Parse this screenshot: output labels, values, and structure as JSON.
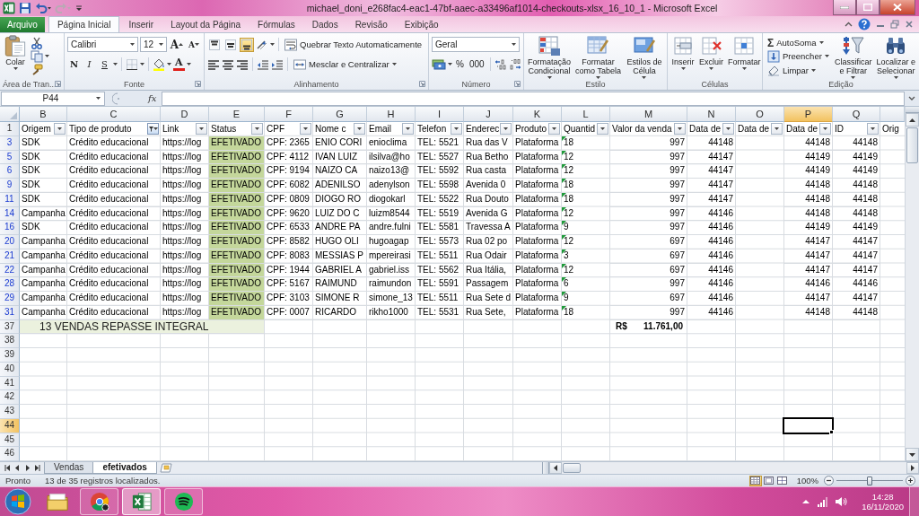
{
  "window": {
    "title": "michael_doni_e268fac4-eac1-47bf-aaec-a33496af1014-checkouts-xlsx_16_10_1  -  Microsoft Excel"
  },
  "quick_access": [
    {
      "kind": "save",
      "disabled": false
    },
    {
      "kind": "undo",
      "disabled": false
    },
    {
      "kind": "redo",
      "disabled": true
    },
    {
      "kind": "customize",
      "disabled": false
    }
  ],
  "ribbon_tabs": [
    {
      "label": "Arquivo",
      "kind": "file",
      "selected": false
    },
    {
      "label": "Página Inicial",
      "kind": "tab",
      "selected": true
    },
    {
      "label": "Inserir",
      "kind": "tab",
      "selected": false
    },
    {
      "label": "Layout da Página",
      "kind": "tab",
      "selected": false
    },
    {
      "label": "Fórmulas",
      "kind": "tab",
      "selected": false
    },
    {
      "label": "Dados",
      "kind": "tab",
      "selected": false
    },
    {
      "label": "Revisão",
      "kind": "tab",
      "selected": false
    },
    {
      "label": "Exibição",
      "kind": "tab",
      "selected": false
    }
  ],
  "ribbon": {
    "clipboard": {
      "label": "Área de Tran...",
      "paste": "Colar"
    },
    "font": {
      "label": "Fonte",
      "font_name": "Calibri",
      "font_size": "12",
      "grow_font": "A",
      "shrink_font": "A",
      "bold": "N",
      "italic": "I",
      "underline": "S",
      "font_color": "A"
    },
    "alignment": {
      "label": "Alinhamento",
      "vertical_align": [
        {
          "selected": false
        },
        {
          "selected": false
        },
        {
          "selected": true
        }
      ],
      "wrap_text": "Quebrar Texto Automaticamente",
      "merge": "Mesclar e Centralizar"
    },
    "number": {
      "label": "Número",
      "format": "Geral",
      "percent": "%",
      "thousands": "000"
    },
    "styles": {
      "label": "Estilo",
      "buttons": [
        {
          "kind": "conditional",
          "lines": [
            "Formatação",
            "Condicional"
          ]
        },
        {
          "kind": "table",
          "lines": [
            "Formatar",
            "como Tabela"
          ]
        },
        {
          "kind": "cell_styles",
          "lines": [
            "Estilos de",
            "Célula"
          ]
        }
      ]
    },
    "cells": {
      "label": "Células",
      "buttons": [
        {
          "kind": "insert",
          "label": "Inserir"
        },
        {
          "kind": "delete",
          "label": "Excluir"
        },
        {
          "kind": "format",
          "label": "Formatar"
        }
      ]
    },
    "editing": {
      "label": "Edição",
      "autosum_symbol": "Σ",
      "autosum": "AutoSoma",
      "fill": "Preencher",
      "clear": "Limpar",
      "sort": [
        "Classificar",
        "e Filtrar"
      ],
      "find": [
        "Localizar e",
        "Selecionar"
      ]
    }
  },
  "formula_bar": {
    "name_box": "P44",
    "function_label": "fx"
  },
  "sheet": {
    "columns": [
      {
        "letter": "B",
        "kind": "text",
        "selected": false
      },
      {
        "letter": "C",
        "kind": "text",
        "selected": false
      },
      {
        "letter": "D",
        "kind": "text",
        "selected": false
      },
      {
        "letter": "E",
        "kind": "status",
        "selected": false
      },
      {
        "letter": "F",
        "kind": "text",
        "selected": false
      },
      {
        "letter": "G",
        "kind": "text",
        "selected": false
      },
      {
        "letter": "H",
        "kind": "text",
        "selected": false
      },
      {
        "letter": "I",
        "kind": "text",
        "selected": false
      },
      {
        "letter": "J",
        "kind": "text",
        "selected": false
      },
      {
        "letter": "K",
        "kind": "text",
        "selected": false
      },
      {
        "letter": "L",
        "kind": "quantity",
        "selected": false
      },
      {
        "letter": "M",
        "kind": "amount",
        "selected": false
      },
      {
        "letter": "N",
        "kind": "number",
        "selected": false
      },
      {
        "letter": "O",
        "kind": "number",
        "selected": false
      },
      {
        "letter": "P",
        "kind": "number",
        "selected": true
      },
      {
        "letter": "Q",
        "kind": "number",
        "selected": false
      },
      {
        "kind": "text",
        "selected": false
      }
    ],
    "header_row": {
      "number": "1",
      "cells": [
        {
          "text": "Origem",
          "kind": "dropdown",
          "filtered": false
        },
        {
          "text": "Tipo de produto",
          "kind": "dropdown",
          "filtered": true
        },
        {
          "text": "Link",
          "kind": "dropdown",
          "filtered": false
        },
        {
          "text": "Status",
          "kind": "dropdown",
          "filtered": false
        },
        {
          "text": "CPF",
          "kind": "dropdown",
          "filtered": false
        },
        {
          "text": "Nome c",
          "kind": "dropdown",
          "filtered": false
        },
        {
          "text": "Email",
          "kind": "dropdown",
          "filtered": false
        },
        {
          "text": "Telefon",
          "kind": "dropdown",
          "filtered": false
        },
        {
          "text": "Enderec",
          "kind": "dropdown",
          "filtered": false
        },
        {
          "text": "Produto",
          "kind": "dropdown",
          "filtered": false
        },
        {
          "text": "Quantid",
          "kind": "dropdown",
          "filtered": false
        },
        {
          "text": "Valor da venda",
          "kind": "dropdown",
          "filtered": false
        },
        {
          "text": "Data de",
          "kind": "dropdown",
          "filtered": false
        },
        {
          "text": "Data de",
          "kind": "dropdown",
          "filtered": false
        },
        {
          "text": "Data de",
          "kind": "dropdown",
          "filtered": false
        },
        {
          "text": "ID",
          "kind": "dropdown",
          "filtered": false
        },
        {
          "text": "Orig",
          "kind": "plain"
        }
      ]
    },
    "rows": [
      {
        "number": "3",
        "filtered": true,
        "flagged": true,
        "cells": [
          "SDK",
          "Crédito educacional",
          "https://log",
          "EFETIVADO",
          "CPF: 2365",
          "ENIO CORI",
          "enioclima",
          "TEL: 5521",
          "Rua das V",
          "Plataforma",
          "18",
          "997",
          "44148",
          null,
          "44148",
          "44148",
          null
        ]
      },
      {
        "number": "5",
        "filtered": true,
        "flagged": true,
        "cells": [
          "SDK",
          "Crédito educacional",
          "https://log",
          "EFETIVADO",
          "CPF: 4112",
          "IVAN LUIZ",
          "ilsilva@ho",
          "TEL: 5527",
          "Rua Betho",
          "Plataforma",
          "12",
          "997",
          "44147",
          null,
          "44149",
          "44149",
          null
        ]
      },
      {
        "number": "6",
        "filtered": true,
        "flagged": true,
        "cells": [
          "SDK",
          "Crédito educacional",
          "https://log",
          "EFETIVADO",
          "CPF: 9194",
          "NAIZO CA",
          "naizo13@",
          "TEL: 5592",
          "Rua casta",
          "Plataforma",
          "12",
          "997",
          "44147",
          null,
          "44149",
          "44149",
          null
        ]
      },
      {
        "number": "9",
        "filtered": true,
        "flagged": true,
        "cells": [
          "SDK",
          "Crédito educacional",
          "https://log",
          "EFETIVADO",
          "CPF: 6082",
          "ADENILSO",
          "adenylson",
          "TEL: 5598",
          "Avenida 0",
          "Plataforma",
          "18",
          "997",
          "44147",
          null,
          "44148",
          "44148",
          null
        ]
      },
      {
        "number": "11",
        "filtered": true,
        "flagged": true,
        "cells": [
          "SDK",
          "Crédito educacional",
          "https://log",
          "EFETIVADO",
          "CPF: 0809",
          "DIOGO RO",
          "diogokarl",
          "TEL: 5522",
          "Rua Douto",
          "Plataforma",
          "18",
          "997",
          "44147",
          null,
          "44148",
          "44148",
          null
        ]
      },
      {
        "number": "14",
        "filtered": true,
        "flagged": true,
        "cells": [
          "Campanha",
          "Crédito educacional",
          "https://log",
          "EFETIVADO",
          "CPF: 9620",
          "LUIZ DO C",
          "luizm8544",
          "TEL: 5519",
          "Avenida G",
          "Plataforma",
          "12",
          "997",
          "44146",
          null,
          "44148",
          "44148",
          null
        ]
      },
      {
        "number": "16",
        "filtered": true,
        "flagged": true,
        "cells": [
          "SDK",
          "Crédito educacional",
          "https://log",
          "EFETIVADO",
          "CPF: 6533",
          "ANDRE PA",
          "andre.fulni",
          "TEL: 5581",
          "Travessa A",
          "Plataforma",
          "9",
          "997",
          "44146",
          null,
          "44149",
          "44149",
          null
        ]
      },
      {
        "number": "20",
        "filtered": true,
        "flagged": true,
        "cells": [
          "Campanha",
          "Crédito educacional",
          "https://log",
          "EFETIVADO",
          "CPF: 8582",
          "HUGO OLI",
          "hugoagap",
          "TEL: 5573",
          "Rua 02 po",
          "Plataforma",
          "12",
          "697",
          "44146",
          null,
          "44147",
          "44147",
          null
        ]
      },
      {
        "number": "21",
        "filtered": true,
        "flagged": true,
        "cells": [
          "Campanha",
          "Crédito educacional",
          "https://log",
          "EFETIVADO",
          "CPF: 8083",
          "MESSIAS P",
          "mpereirasi",
          "TEL: 5511",
          "Rua Odair",
          "Plataforma",
          "3",
          "697",
          "44146",
          null,
          "44147",
          "44147",
          null
        ]
      },
      {
        "number": "22",
        "filtered": true,
        "flagged": true,
        "cells": [
          "Campanha",
          "Crédito educacional",
          "https://log",
          "EFETIVADO",
          "CPF: 1944",
          "GABRIEL A",
          "gabriel.iss",
          "TEL: 5562",
          "Rua Itália,",
          "Plataforma",
          "12",
          "697",
          "44146",
          null,
          "44147",
          "44147",
          null
        ]
      },
      {
        "number": "28",
        "filtered": true,
        "flagged": true,
        "cells": [
          "Campanha",
          "Crédito educacional",
          "https://log",
          "EFETIVADO",
          "CPF: 5167",
          "RAIMUND",
          "raimundon",
          "TEL: 5591",
          "Passagem",
          "Plataforma",
          "6",
          "997",
          "44146",
          null,
          "44146",
          "44146",
          null
        ]
      },
      {
        "number": "29",
        "filtered": true,
        "flagged": true,
        "cells": [
          "Campanha",
          "Crédito educacional",
          "https://log",
          "EFETIVADO",
          "CPF: 3103",
          "SIMONE R",
          "simone_13",
          "TEL: 5511",
          "Rua Sete d",
          "Plataforma",
          "9",
          "697",
          "44146",
          null,
          "44147",
          "44147",
          null
        ]
      },
      {
        "number": "31",
        "filtered": true,
        "flagged": true,
        "cells": [
          "Campanha",
          "Crédito educacional",
          "https://log",
          "EFETIVADO",
          "CPF: 0007",
          "RICARDO",
          "rikho1000",
          "TEL: 5531",
          "Rua Sete,",
          "Plataforma",
          "18",
          "997",
          "44146",
          null,
          "44148",
          "44148",
          null
        ]
      }
    ],
    "total_row": {
      "number": "37",
      "label": "13 VENDAS REPASSE INTEGRAL",
      "currency": "R$",
      "value": "11.761,00"
    },
    "empty_rows": [
      {
        "number": "38",
        "selected": false
      },
      {
        "number": "39",
        "selected": false
      },
      {
        "number": "40",
        "selected": false
      },
      {
        "number": "41",
        "selected": false
      },
      {
        "number": "42",
        "selected": false
      },
      {
        "number": "43",
        "selected": false
      },
      {
        "number": "44",
        "selected": true
      },
      {
        "number": "45",
        "selected": false
      },
      {
        "number": "46",
        "selected": false
      }
    ]
  },
  "sheet_tabs": [
    {
      "label": "Vendas",
      "selected": false
    },
    {
      "label": "efetivados",
      "selected": true
    }
  ],
  "status_bar": {
    "mode": "Pronto",
    "message": "13 de 35 registros localizados.",
    "views": [
      {
        "kind": "normal",
        "selected": true
      },
      {
        "kind": "page_layout",
        "selected": false
      },
      {
        "kind": "page_break",
        "selected": false
      }
    ],
    "zoom": "100%",
    "zoom_slider": {
      "level": 0.5
    }
  },
  "taskbar": {
    "apps": [
      {
        "kind": "folder",
        "open": false,
        "selected": false
      },
      {
        "kind": "browser",
        "open": true,
        "selected": false
      },
      {
        "kind": "spreadsheet",
        "open": true,
        "selected": true
      },
      {
        "kind": "music",
        "open": true,
        "selected": false
      }
    ],
    "clock": {
      "time": "14:28",
      "date": "16/11/2020"
    }
  }
}
